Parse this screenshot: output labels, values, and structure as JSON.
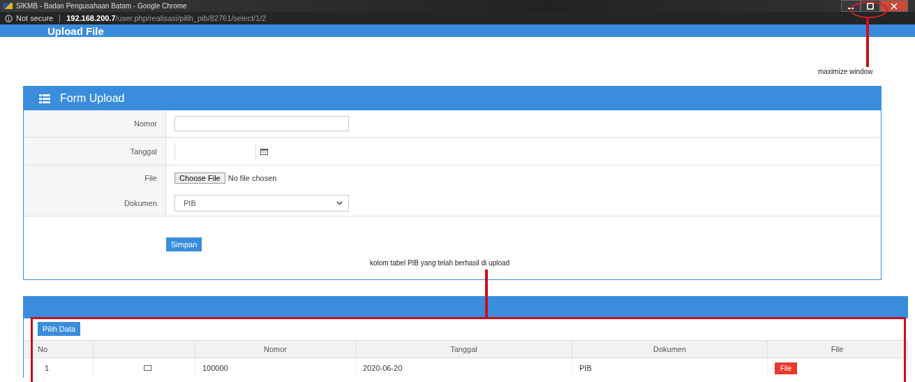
{
  "window": {
    "title": "SIKMB - Badan Pengusahaan Batam - Google Chrome"
  },
  "address_bar": {
    "security": "Not secure",
    "host": "192.168.200.7",
    "path": "/user.php/realisasi/pilih_pib/82761/select/1/2"
  },
  "page_header": "Upload File",
  "form": {
    "title": "Form Upload",
    "fields": [
      {
        "kind": "text",
        "label": "Nomor"
      },
      {
        "kind": "date",
        "label": "Tanggal"
      },
      {
        "kind": "file",
        "label": "File",
        "button": "Choose File",
        "status": "No file chosen"
      },
      {
        "kind": "select",
        "label": "Dokumen",
        "value": "PIB"
      }
    ],
    "submit": "Simpan"
  },
  "table": {
    "action": "Pilih Data",
    "columns": [
      "No",
      "",
      "Nomor",
      "Tanggal",
      "Dokumen",
      "File"
    ],
    "rows": [
      {
        "no": "1",
        "checked": false,
        "nomor": "100000",
        "tanggal": "2020-06-20",
        "dokumen": "PIB",
        "file": "File"
      }
    ]
  },
  "annotations": [
    {
      "kind": "window",
      "text": "maximize window"
    },
    {
      "kind": "table",
      "text": "kolom tabel PIB yang telah berhasil di upload"
    }
  ]
}
